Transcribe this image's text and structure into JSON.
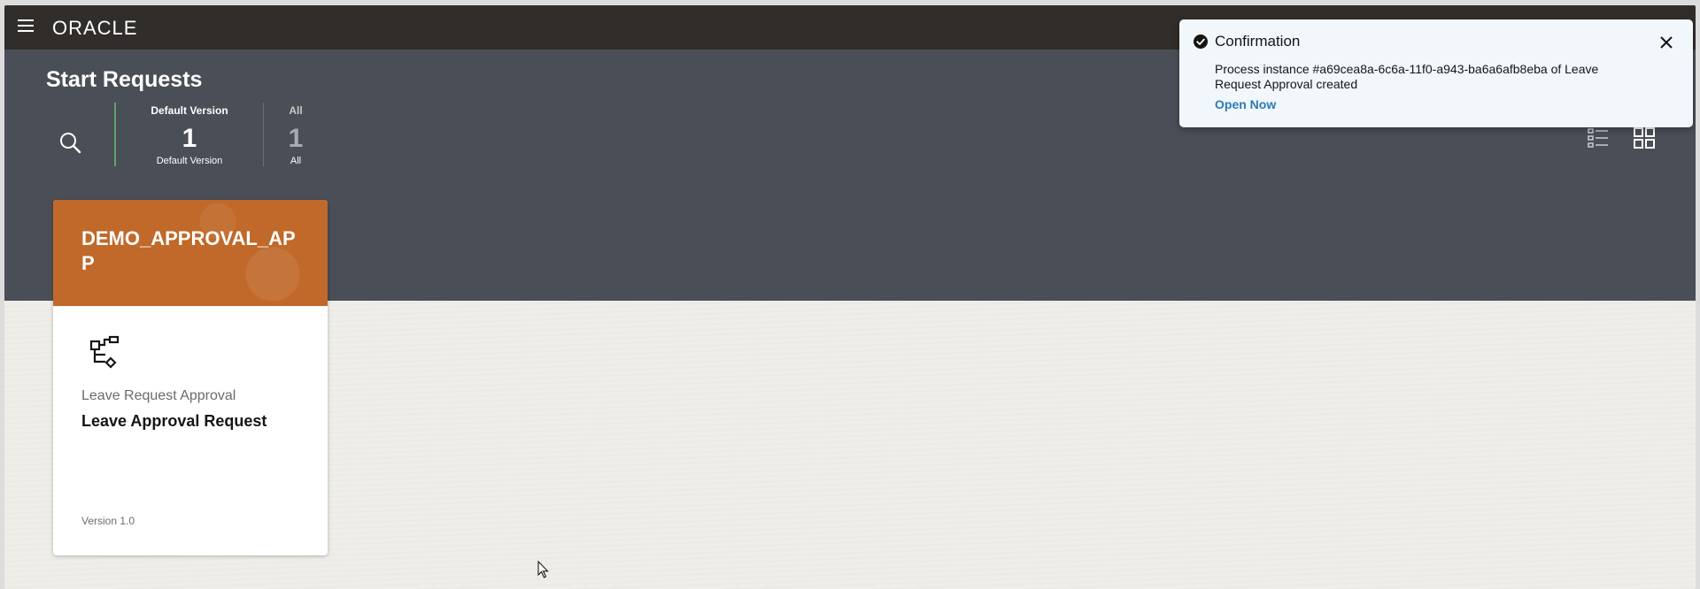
{
  "app": {
    "logo_text": "ORACLE",
    "menu_icon": "hamburger-icon"
  },
  "page": {
    "title": "Start Requests"
  },
  "search": {
    "icon": "search-icon"
  },
  "filters": [
    {
      "label": "Default Version",
      "count": "1",
      "sub": "Default Version"
    },
    {
      "label": "All",
      "count": "1",
      "sub": "All"
    }
  ],
  "view_toggles": {
    "list_icon": "list-view-icon",
    "grid_icon": "grid-view-icon"
  },
  "card": {
    "app_name": "DEMO_APPROVAL_APP",
    "subtitle": "Leave Request Approval",
    "title": "Leave Approval Request",
    "version": "Version 1.0",
    "icon": "process-flow-icon",
    "accent_color": "#c0692a"
  },
  "toast": {
    "title": "Confirmation",
    "message": "Process instance #a69cea8a-6c6a-11f0-a943-ba6a6afb8eba of Leave Request Approval created",
    "link": "Open Now",
    "icon": "check-circle-icon",
    "close_icon": "close-icon"
  },
  "colors": {
    "topbar": "#312d2a",
    "hero": "#4a4e57",
    "canvas": "#efede8",
    "link": "#2c7bb5",
    "active_filter": "#5fa56a"
  }
}
